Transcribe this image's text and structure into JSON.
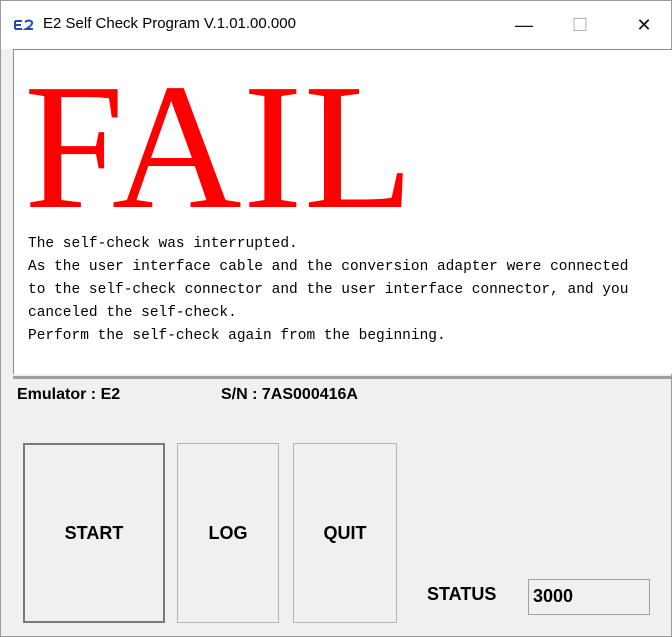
{
  "window": {
    "title": "E2 Self Check Program V.1.01.00.000",
    "app_icon": "e2-logo-icon",
    "minimize_glyph": "—",
    "maximize_glyph": "☐",
    "close_glyph": "✕"
  },
  "result": {
    "verdict": "FAIL",
    "verdict_color": "#ff0000",
    "message": "The self-check was interrupted.\nAs the user interface cable and the conversion adapter were connected\nto the self-check connector and the user interface connector, and you\ncanceled the self-check.\nPerform the self-check again from the beginning."
  },
  "device": {
    "emulator_label": "Emulator : E2",
    "serial_label": "S/N : 7AS000416A"
  },
  "buttons": {
    "start": "START",
    "log": "LOG",
    "quit": "QUIT"
  },
  "status": {
    "label": "STATUS",
    "value": "3000"
  }
}
